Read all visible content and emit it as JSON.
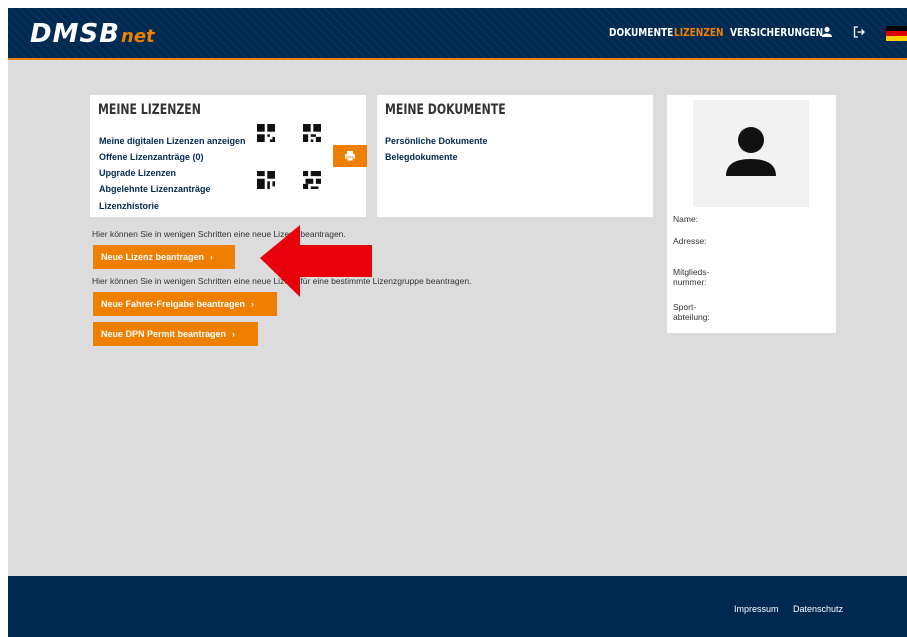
{
  "header": {
    "logo_main": "DMSB",
    "logo_suffix": "net",
    "nav": [
      {
        "label": "DOKUMENTE",
        "active": false
      },
      {
        "label": "LIZENZEN",
        "active": true
      },
      {
        "label": "VERSICHERUNGEN",
        "active": false
      }
    ],
    "icons": [
      "user-icon",
      "logout-icon",
      "german-flag-icon"
    ],
    "colors": {
      "navy": "#002952",
      "accent": "#ee7f00"
    }
  },
  "lizenzen_card": {
    "title": "MEINE LIZENZEN",
    "links": [
      "Meine digitalen Lizenzen anzeigen",
      "Offene Lizenzanträge (0)",
      "Upgrade Lizenzen",
      "Abgelehnte Lizenzanträge",
      "Lizenzhistorie"
    ],
    "print_icon": "printer-icon"
  },
  "dokumente_card": {
    "title": "MEINE DOKUMENTE",
    "links": [
      "Persönliche Dokumente",
      "Belegdokumente"
    ]
  },
  "profile": {
    "avatar_icon": "person-icon",
    "labels": {
      "name": "Name:",
      "adresse": "Adresse:",
      "mitglied_1": "Mitglieds-",
      "mitglied_2": "nummer:",
      "sport_1": "Sport-",
      "sport_2": "abteilung:"
    }
  },
  "actions": {
    "info_lizenz": "Hier können Sie in wenigen Schritten eine neue Lizenz beantragen.",
    "btn_lizenz": "Neue Lizenz beantragen",
    "info_gruppe": "Hier können Sie in wenigen Schritten eine neue Lizenz für eine bestimmte Lizenzgruppe beantragen.",
    "btn_fahrer": "Neue Fahrer-Freigabe beantragen",
    "btn_dpn": "Neue DPN Permit beantragen",
    "chevron": "›"
  },
  "footer": {
    "impressum": "Impressum",
    "datenschutz": "Datenschutz"
  }
}
